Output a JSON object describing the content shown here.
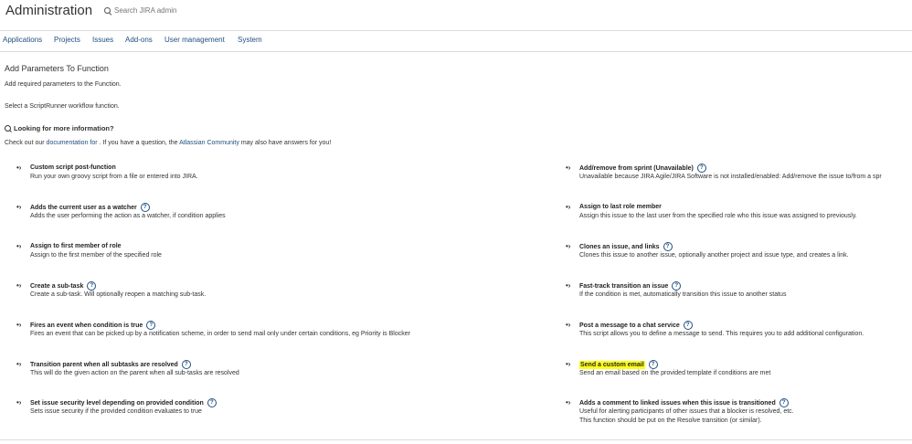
{
  "header": {
    "title": "Administration",
    "search_placeholder": "Search JIRA admin"
  },
  "nav": {
    "items": [
      "Applications",
      "Projects",
      "Issues",
      "Add-ons",
      "User management",
      "System"
    ]
  },
  "page": {
    "title": "Add Parameters To Function",
    "intro_line1": "Add required parameters to the Function.",
    "intro_line2": "Select a ScriptRunner workflow function.",
    "info_heading": "Looking for more information?",
    "info_prefix": "Check out our",
    "info_link1": "documentation for .",
    "info_middle": "If you have a question, the",
    "info_link2": "Atlassian Community",
    "info_suffix": "may also have answers for you!"
  },
  "functions_left": [
    {
      "name": "Custom script post-function",
      "desc": "Run your own groovy script from a file or entered into JIRA.",
      "help": false
    },
    {
      "name": "Adds the current user as a watcher",
      "desc": "Adds the user performing the action as a watcher, if condition applies",
      "help": true
    },
    {
      "name": "Assign to first member of role",
      "desc": "Assign to the first member of the specified role",
      "help": false
    },
    {
      "name": "Create a sub-task",
      "desc": "Create a sub-task. Will optionally reopen a matching sub-task.",
      "help": true
    },
    {
      "name": "Fires an event when condition is true",
      "desc": "Fires an event that can be picked up by a notification scheme, in order to send mail only under certain conditions, eg Priority is Blocker",
      "help": true
    },
    {
      "name": "Transition parent when all subtasks are resolved",
      "desc": "This will do the given action on the parent when all sub-tasks are resolved",
      "help": true
    },
    {
      "name": "Set issue security level depending on provided condition",
      "desc": "Sets issue security if the provided condition evaluates to true",
      "help": true
    }
  ],
  "functions_right": [
    {
      "name": "Add/remove from sprint (Unavailable)",
      "desc": "Unavailable because JIRA Agile/JIRA Software is not installed/enabled: Add/remove the issue to/from a spr",
      "help": true
    },
    {
      "name": "Assign to last role member",
      "desc": "Assign this issue to the last user from the specified role who this issue was assigned to previously.",
      "help": false
    },
    {
      "name": "Clones an issue, and links",
      "desc": "Clones this issue to another issue, optionally another project and issue type, and creates a link.",
      "help": true
    },
    {
      "name": "Fast-track transition an issue",
      "desc": "If the condition is met, automatically transition this issue to another status",
      "help": true
    },
    {
      "name": "Post a message to a chat service",
      "desc": "This script allows you to define a message to send. This requires you to add additional configuration.",
      "help": true
    },
    {
      "name": "Send a custom email",
      "desc": "Send an email based on the provided template if conditions are met",
      "help": true,
      "highlighted": true
    },
    {
      "name": "Adds a comment to linked issues when this issue is transitioned",
      "desc": "Useful for alerting participants of other issues that a blocker is resolved, etc.",
      "desc2": "This function should be put on the Resolve transition (or similar).",
      "help": true
    }
  ],
  "colors": {
    "link": "#205081",
    "highlight": "#ffff1a"
  }
}
